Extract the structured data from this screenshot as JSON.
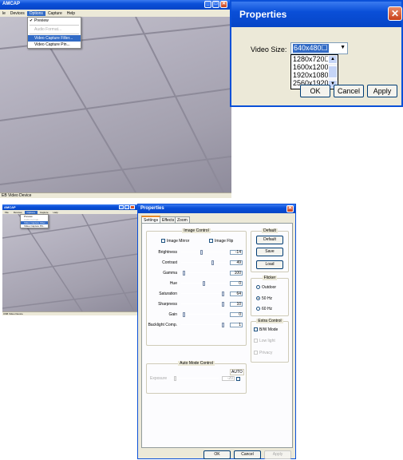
{
  "top_window": {
    "title": "AMCAP",
    "menu": [
      "le",
      "Devices",
      "Options",
      "Capture",
      "Help"
    ],
    "options_menu": [
      "Preview",
      "Audio Format...",
      "Video Capture Filter...",
      "Video Capture Pin..."
    ],
    "status": "EB Video Device"
  },
  "properties_popup": {
    "title": "Properties",
    "video_size_label": "Video Size:",
    "video_size_value": "640x480☐",
    "options": [
      "1280x720☐",
      "1600x1200☐",
      "1920x1080☐",
      "2560x1920☐"
    ],
    "ok": "OK",
    "cancel": "Cancel",
    "apply": "Apply"
  },
  "small_window": {
    "title": "AMCAP",
    "menu": [
      "File",
      "Devices",
      "Options",
      "Capture",
      "Help"
    ],
    "options_menu": [
      "Preview",
      "Audio Format...",
      "Video Capture Filter...",
      "Video Capture Pin..."
    ],
    "status": "USB Video Device"
  },
  "properties_dialog": {
    "title": "Properties",
    "tabs": [
      "Settings",
      "Effects",
      "Zoom"
    ],
    "image_control": {
      "title": "Image Control",
      "mirror": "Image Mirror",
      "flip": "Image Flip",
      "sliders": [
        {
          "label": "Brightness",
          "value": "-14",
          "level": 0.45
        },
        {
          "label": "Contrast",
          "value": "49",
          "level": 0.7
        },
        {
          "label": "Gamma",
          "value": "100",
          "level": 0.03
        },
        {
          "label": "Hue",
          "value": "0",
          "level": 0.5
        },
        {
          "label": "Saturation",
          "value": "64",
          "level": 0.95
        },
        {
          "label": "Sharpness",
          "value": "10",
          "level": 0.95
        },
        {
          "label": "Gain",
          "value": "0",
          "level": 0.03
        },
        {
          "label": "Backlight Comp.",
          "value": "1",
          "level": 0.95
        }
      ]
    },
    "default_group": {
      "title": "Default",
      "default": "Default",
      "save": "Save",
      "load": "Load"
    },
    "flicker": {
      "title": "Flicker",
      "options": [
        "Outdoor",
        "50 Hz",
        "60 Hz"
      ],
      "selected": 1
    },
    "extra_control": {
      "title": "Extra Control",
      "options": [
        "B/W Mode",
        "Low light",
        "Privacy"
      ]
    },
    "auto_mode": {
      "title": "Auto Mode Control",
      "auto": "AUTO",
      "exposure_label": "Exposure",
      "exposure_value": "-20"
    },
    "ok": "OK",
    "cancel": "Cancel",
    "apply": "Apply"
  }
}
